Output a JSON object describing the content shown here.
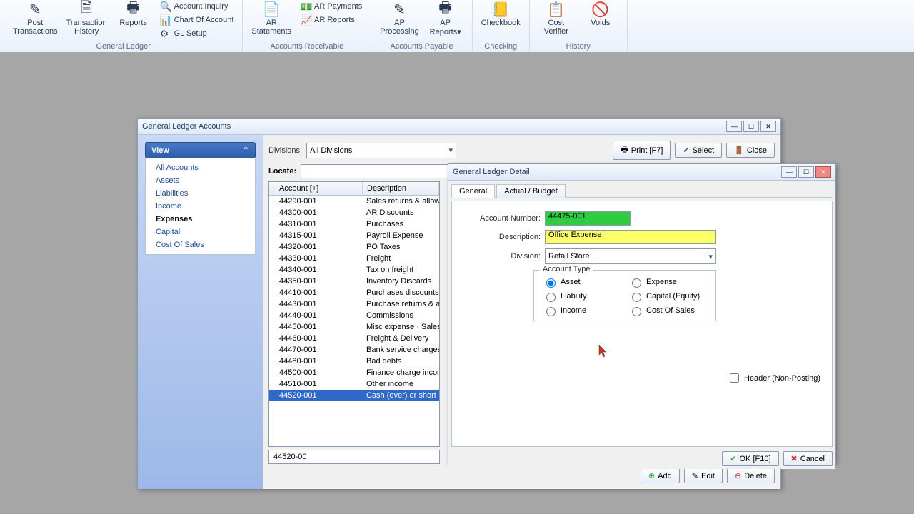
{
  "ribbon": {
    "groups": [
      {
        "label": "General Ledger",
        "big": [
          {
            "icon": "✎",
            "label": "Post\nTransactions"
          },
          {
            "icon": "🗎",
            "label": "Transaction\nHistory"
          },
          {
            "icon": "🖶",
            "label": "Reports"
          }
        ],
        "small": [
          {
            "icon": "🔍",
            "label": "Account Inquiry"
          },
          {
            "icon": "📊",
            "label": "Chart Of Account"
          },
          {
            "icon": "⚙",
            "label": "GL Setup"
          }
        ]
      },
      {
        "label": "Accounts Receivable",
        "big": [
          {
            "icon": "📄",
            "label": "AR\nStatements"
          }
        ],
        "small": [
          {
            "icon": "💵",
            "label": "AR Payments"
          },
          {
            "icon": "📈",
            "label": "AR Reports"
          }
        ]
      },
      {
        "label": "Accounts Payable",
        "big": [
          {
            "icon": "✎",
            "label": "AP\nProcessing"
          },
          {
            "icon": "🖶",
            "label": "AP\nReports▾"
          }
        ]
      },
      {
        "label": "Checking",
        "big": [
          {
            "icon": "📒",
            "label": "Checkbook"
          }
        ]
      },
      {
        "label": "History",
        "big": [
          {
            "icon": "📋",
            "label": "Cost\nVerifier"
          },
          {
            "icon": "🚫",
            "label": "Voids"
          }
        ]
      }
    ]
  },
  "gla": {
    "title": "General Ledger Accounts",
    "view_label": "View",
    "views": [
      "All Accounts",
      "Assets",
      "Liabilities",
      "Income",
      "Expenses",
      "Capital",
      "Cost Of Sales"
    ],
    "view_selected": "Expenses",
    "divisions_label": "Divisions:",
    "divisions_value": "All Divisions",
    "print_label": "Print [F7]",
    "select_label": "Select",
    "close_label": "Close",
    "locate_label": "Locate:",
    "col_account": "Account [+]",
    "col_desc": "Description",
    "rows": [
      {
        "a": "44290-001",
        "d": "Sales returns & allowance"
      },
      {
        "a": "44300-001",
        "d": "AR Discounts"
      },
      {
        "a": "44310-001",
        "d": "Purchases"
      },
      {
        "a": "44315-001",
        "d": "Payroll Expense"
      },
      {
        "a": "44320-001",
        "d": "PO Taxes"
      },
      {
        "a": "44330-001",
        "d": "Freight"
      },
      {
        "a": "44340-001",
        "d": "Tax on freight"
      },
      {
        "a": "44350-001",
        "d": "Inventory Discards"
      },
      {
        "a": "44410-001",
        "d": "Purchases discounts"
      },
      {
        "a": "44430-001",
        "d": "Purchase returns & allowa"
      },
      {
        "a": "44440-001",
        "d": "Commissions"
      },
      {
        "a": "44450-001",
        "d": "Misc expense · Sales"
      },
      {
        "a": "44460-001",
        "d": "Freight & Delivery"
      },
      {
        "a": "44470-001",
        "d": "Bank service charges"
      },
      {
        "a": "44480-001",
        "d": "Bad debts"
      },
      {
        "a": "44500-001",
        "d": "Finance charge income"
      },
      {
        "a": "44510-001",
        "d": "Other income"
      },
      {
        "a": "44520-001",
        "d": "Cash (over) or short"
      }
    ],
    "selected_row": 17,
    "footer_value": "44520-00",
    "add_label": "Add",
    "edit_label": "Edit",
    "delete_label": "Delete"
  },
  "detail": {
    "title": "General Ledger Detail",
    "tab_general": "General",
    "tab_actual": "Actual / Budget",
    "account_number_label": "Account Number:",
    "account_number": "44475-001",
    "description_label": "Description:",
    "description": "Office Expense",
    "division_label": "Division:",
    "division": "Retail Store",
    "account_type_label": "Account Type",
    "types": [
      "Asset",
      "Expense",
      "Liability",
      "Capital (Equity)",
      "Income",
      "Cost Of Sales"
    ],
    "type_selected": "Asset",
    "header_label": "Header (Non-Posting)",
    "ok_label": "OK [F10]",
    "cancel_label": "Cancel"
  }
}
